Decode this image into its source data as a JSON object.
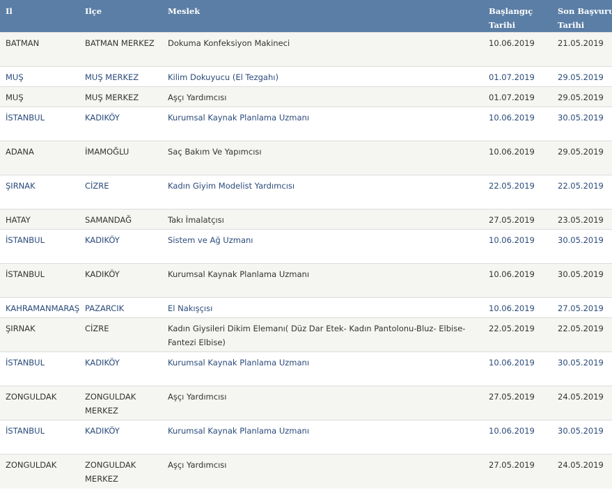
{
  "table": {
    "headers": {
      "il": "Il",
      "ilce": "Ilçe",
      "meslek": "Meslek",
      "baslangic": "Başlangıç Tarihi",
      "son_basvuru": "Son Başvuru Tarihi"
    },
    "rows": [
      {
        "il": "BATMAN",
        "ilce": "BATMAN MERKEZ",
        "meslek": "Dokuma Konfeksiyon Makineci",
        "baslangic": "10.06.2019",
        "son_basvuru": "21.05.2019"
      },
      {
        "il": "MUŞ",
        "ilce": "MUŞ MERKEZ",
        "meslek": "Kilim Dokuyucu (El Tezgahı)",
        "baslangic": "01.07.2019",
        "son_basvuru": "29.05.2019"
      },
      {
        "il": "MUŞ",
        "ilce": "MUŞ MERKEZ",
        "meslek": "Aşçı Yardımcısı",
        "baslangic": "01.07.2019",
        "son_basvuru": "29.05.2019"
      },
      {
        "il": "İSTANBUL",
        "ilce": "KADIKÖY",
        "meslek": "Kurumsal Kaynak Planlama Uzmanı",
        "baslangic": "10.06.2019",
        "son_basvuru": "30.05.2019"
      },
      {
        "il": "ADANA",
        "ilce": "İMAMOĞLU",
        "meslek": "Saç Bakım Ve Yapımcısı",
        "baslangic": "10.06.2019",
        "son_basvuru": "29.05.2019"
      },
      {
        "il": "ŞIRNAK",
        "ilce": "CİZRE",
        "meslek": "Kadın Giyim Modelist Yardımcısı",
        "baslangic": "22.05.2019",
        "son_basvuru": "22.05.2019"
      },
      {
        "il": "HATAY",
        "ilce": "SAMANDAĞ",
        "meslek": "Takı İmalatçısı",
        "baslangic": "27.05.2019",
        "son_basvuru": "23.05.2019"
      },
      {
        "il": "İSTANBUL",
        "ilce": "KADIKÖY",
        "meslek": "Sistem ve Ağ Uzmanı",
        "baslangic": "10.06.2019",
        "son_basvuru": "30.05.2019"
      },
      {
        "il": "İSTANBUL",
        "ilce": "KADIKÖY",
        "meslek": "Kurumsal Kaynak Planlama Uzmanı",
        "baslangic": "10.06.2019",
        "son_basvuru": "30.05.2019"
      },
      {
        "il": "KAHRAMANMARAŞ",
        "ilce": "PAZARCIK",
        "meslek": "El Nakışçısı",
        "baslangic": "10.06.2019",
        "son_basvuru": "27.05.2019"
      },
      {
        "il": "ŞIRNAK",
        "ilce": "CİZRE",
        "meslek": "Kadın Giysileri Dikim Elemanı( Düz Dar Etek- Kadın Pantolonu-Bluz- Elbise- Fantezi Elbise)",
        "baslangic": "22.05.2019",
        "son_basvuru": "22.05.2019"
      },
      {
        "il": "İSTANBUL",
        "ilce": "KADIKÖY",
        "meslek": "Kurumsal Kaynak Planlama Uzmanı",
        "baslangic": "10.06.2019",
        "son_basvuru": "30.05.2019"
      },
      {
        "il": "ZONGULDAK",
        "ilce": "ZONGULDAK MERKEZ",
        "meslek": "Aşçı Yardımcısı",
        "baslangic": "27.05.2019",
        "son_basvuru": "24.05.2019"
      },
      {
        "il": "İSTANBUL",
        "ilce": "KADIKÖY",
        "meslek": "Kurumsal Kaynak Planlama Uzmanı",
        "baslangic": "10.06.2019",
        "son_basvuru": "30.05.2019"
      },
      {
        "il": "ZONGULDAK",
        "ilce": "ZONGULDAK MERKEZ",
        "meslek": "Aşçı Yardımcısı",
        "baslangic": "27.05.2019",
        "son_basvuru": "24.05.2019"
      }
    ]
  }
}
